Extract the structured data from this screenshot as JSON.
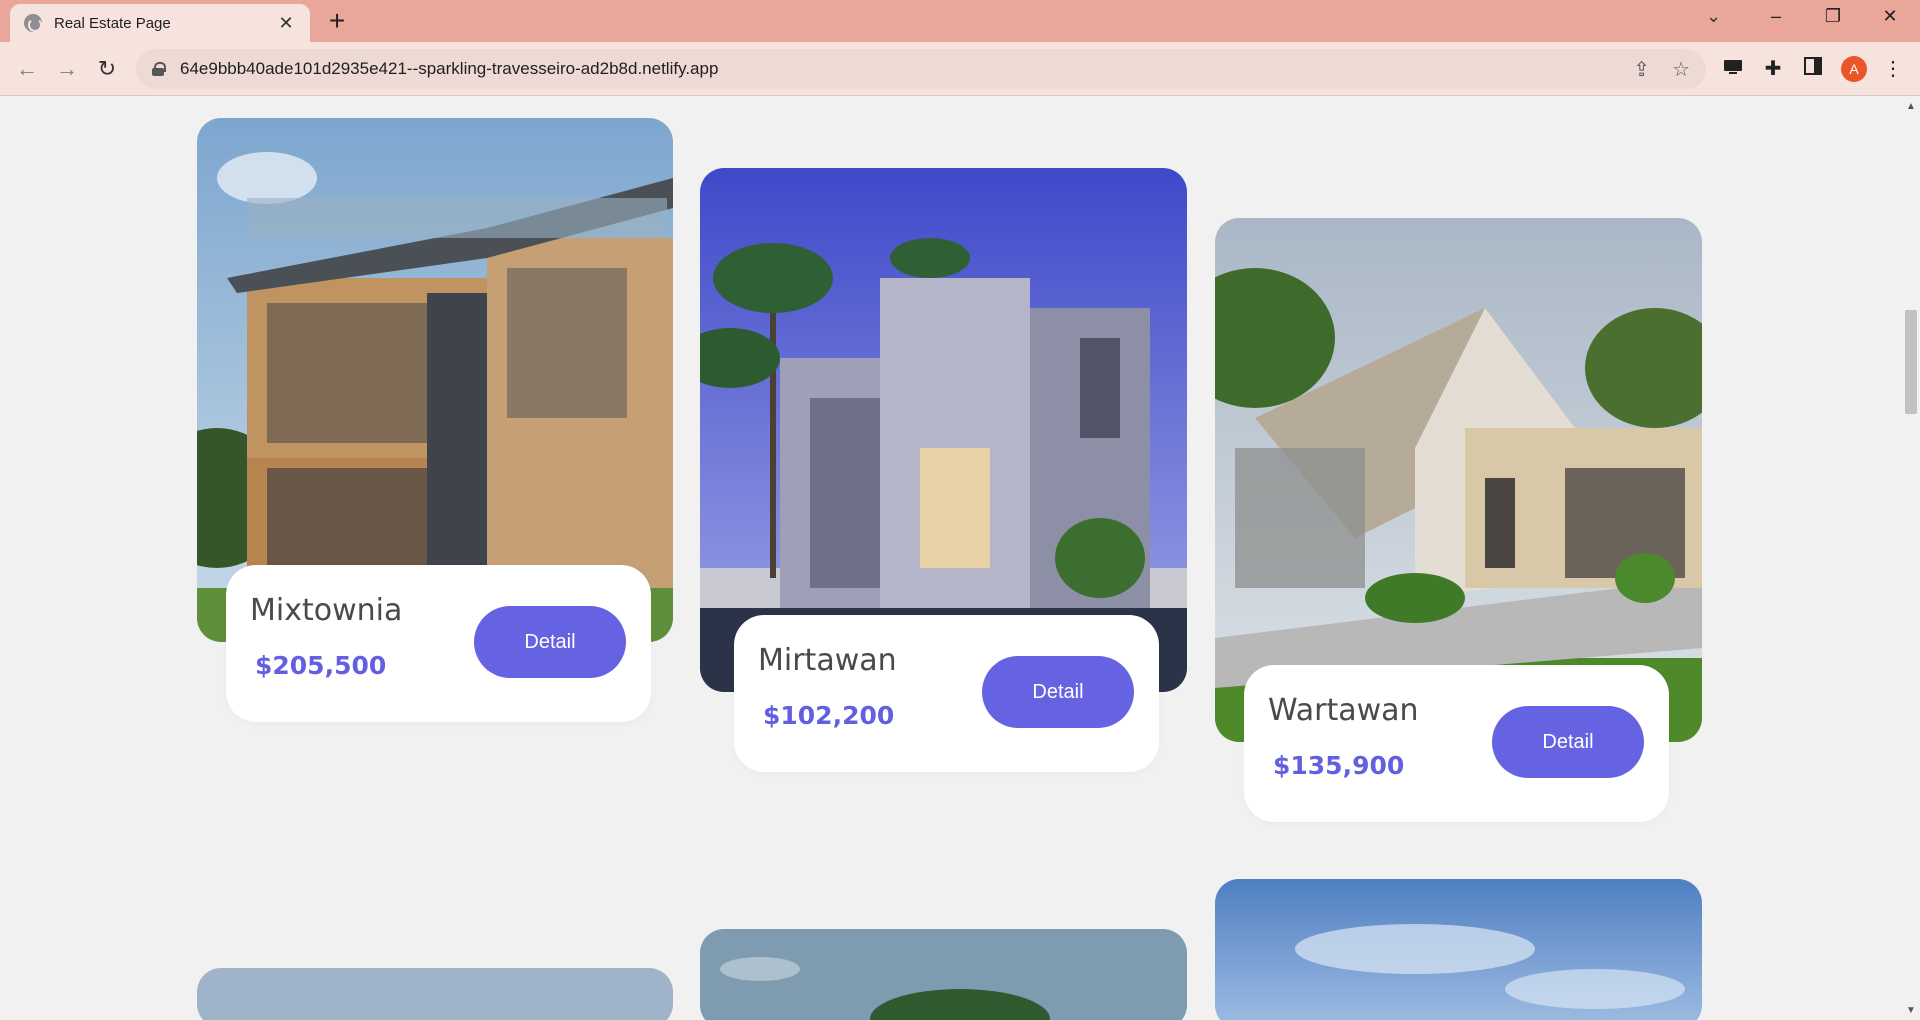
{
  "browser": {
    "tab_title": "Real Estate Page",
    "tab_close": "✕",
    "new_tab": "+",
    "tab_search": "⌄",
    "minimize": "–",
    "restore": "❐",
    "close": "✕",
    "url": "64e9bbb40ade101d2935e421--sparkling-travesseiro-ad2b8d.netlify.app",
    "back": "←",
    "forward": "→",
    "reload": "↻",
    "share": "⇪",
    "star": "☆",
    "extensions": "✚",
    "profile_initial": "A",
    "menu": "⋮"
  },
  "properties": [
    {
      "name": "Mixtownia",
      "price": "$205,500",
      "button": "Detail"
    },
    {
      "name": "Mirtawan",
      "price": "$102,200",
      "button": "Detail"
    },
    {
      "name": "Wartawan",
      "price": "$135,900",
      "button": "Detail"
    }
  ],
  "colors": {
    "accent": "#6663e2",
    "price": "#6260e0",
    "page_bg": "#f1f1f1",
    "tabstrip": "#e8a799"
  }
}
